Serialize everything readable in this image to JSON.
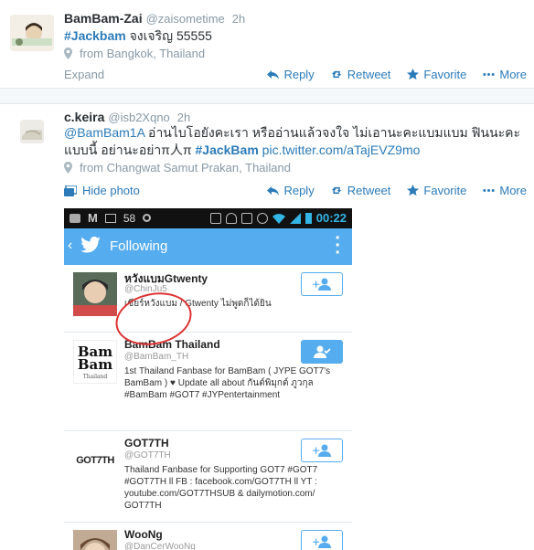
{
  "tweets": [
    {
      "name": "BamBam-Zai",
      "handle": "@zaisometime",
      "time": "2h",
      "hashtag": "#Jackbam",
      "text_after": " จงเจริญ 55555",
      "location": "from Bangkok, Thailand",
      "expand_label": "Expand"
    },
    {
      "name": "c.keira",
      "handle": "@isb2Xqno",
      "time": "2h",
      "mention": "@BamBam1A",
      "text_body": " อ่านไบโอยังคะเรา หรืออ่านแล้วจงใจ ไม่เอานะคะแบมแบม ฟินนะคะแบบนี้ อย่านะอย่าπ人π ",
      "hashtag": "#JackBam",
      "pic_link": " pic.twitter.com/aTajEVZ9mo",
      "location": "from Changwat Samut Prakan, Thailand",
      "hide_photo_label": "Hide photo"
    }
  ],
  "actions": {
    "reply": "Reply",
    "retweet": "Retweet",
    "favorite": "Favorite",
    "more": "More"
  },
  "phone": {
    "statusbar": {
      "battery_count": "58",
      "clock": "00:22"
    },
    "actionbar": {
      "back": "‹",
      "title": "Following"
    },
    "profiles": [
      {
        "name": "หวังแบมGtwenty",
        "handle": "@ChinJu5",
        "bio": "เชียร์หวังแบม / Gtwenty ไม่พูดก็ได้ยิน",
        "following": false
      },
      {
        "name": "BamBam Thailand",
        "handle": "@BamBam_TH",
        "bio": "1st Thailand Fanbase for BamBam ( JYPE GOT7's BamBam ) ♥ Update all about กันต์พิมุกต์ ภูวกุล #BamBam #GOT7 #JYPentertainment",
        "following": true,
        "avatar_text1": "Bam",
        "avatar_text2": "Bam",
        "avatar_text3": "Thailand"
      },
      {
        "name": "GOT7TH",
        "handle": "@GOT7TH",
        "bio": "Thailand Fanbase for Supporting GOT7 #GOT7 #GOT7TH ll FB : facebook.com/GOT7TH ll YT : youtube.com/GOT7THSUB & dailymotion.com/ GOT7TH",
        "following": false,
        "avatar_text": "GOT7TH"
      },
      {
        "name": "WooNg",
        "handle": "@DanCerWooNg",
        "bio": "",
        "following": false
      }
    ]
  },
  "colors": {
    "link": "#2b7bb9",
    "twitter_blue": "#55acee",
    "annotation_circle": "#dd3333"
  }
}
